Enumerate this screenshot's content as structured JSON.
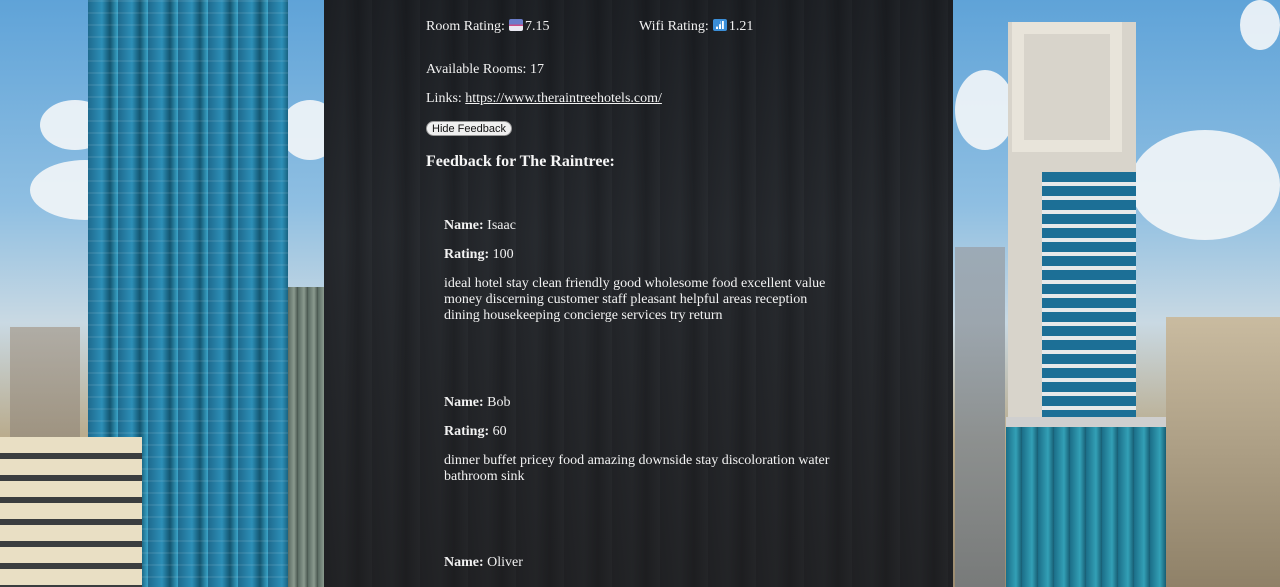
{
  "hotel": {
    "room_rating_label": "Room Rating:",
    "room_rating_value": "7.15",
    "wifi_rating_label": "Wifi Rating:",
    "wifi_rating_value": "1.21",
    "available_rooms_label": "Available Rooms:",
    "available_rooms_value": "17",
    "links_label": "Links:",
    "link_url": "https://www.theraintreehotels.com/",
    "hide_feedback_button": "Hide Feedback",
    "feedback_title": "Feedback for The Raintree:"
  },
  "icons": {
    "room_rating": "bed-icon",
    "wifi_rating": "signal-bars-icon"
  },
  "feedback": [
    {
      "name_label": "Name:",
      "name": "Isaac",
      "rating_label": "Rating:",
      "rating": "100",
      "comment": "ideal hotel stay clean friendly good wholesome food excellent value money discerning customer staff pleasant helpful areas reception dining housekeeping concierge services try return"
    },
    {
      "name_label": "Name:",
      "name": "Bob",
      "rating_label": "Rating:",
      "rating": "60",
      "comment": "dinner buffet pricey food amazing downside stay discoloration water bathroom sink"
    },
    {
      "name_label": "Name:",
      "name": "Oliver"
    }
  ]
}
